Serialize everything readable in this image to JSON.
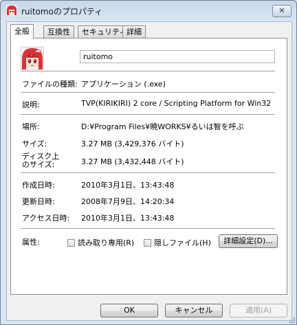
{
  "window": {
    "title": "ruitomoのプロパティ",
    "close_glyph": "✕"
  },
  "tabs": [
    {
      "label": "全般",
      "active": true
    },
    {
      "label": "互換性",
      "active": false
    },
    {
      "label": "セキュリティ",
      "active": false
    },
    {
      "label": "詳細",
      "active": false
    }
  ],
  "general": {
    "file_name": "ruitomo",
    "file_type_label": "ファイルの種類:",
    "file_type_value": "アプリケーション (.exe)",
    "description_label": "説明:",
    "description_value": "TVP(KIRIKIRI) 2 core / Scripting Platform for Win32",
    "location_label": "場所:",
    "location_value": "D:¥Program Files¥暁WORKS¥るいは智を呼ぶ",
    "size_label": "サイズ:",
    "size_value": "3.27 MB (3,429,376 バイト)",
    "size_on_disk_label_line1": "ディスク上",
    "size_on_disk_label_line2": "のサイズ:",
    "size_on_disk_value": "3.27 MB (3,432,448 バイト)",
    "created_label": "作成日時:",
    "created_value": "2010年3月1日、13:43:48",
    "modified_label": "更新日時:",
    "modified_value": "2008年7月9日、14:20:34",
    "accessed_label": "アクセス日時:",
    "accessed_value": "2010年3月1日、13:43:48",
    "attributes_label": "属性:",
    "readonly_label": "読み取り専用(R)",
    "readonly_checked": false,
    "hidden_label": "隠しファイル(H)",
    "hidden_checked": false,
    "advanced_button": "詳細設定(D)..."
  },
  "footer": {
    "ok": "OK",
    "cancel": "キャンセル",
    "apply": "適用(A)",
    "apply_disabled": true
  },
  "colors": {
    "window_frame": "#dbe5f1",
    "panel_bg": "#ffffff",
    "icon_hair": "#d8323a"
  },
  "icons": {
    "app": "ruitomo-app-icon",
    "close": "close-icon",
    "resize": "resize-grip-icon"
  }
}
